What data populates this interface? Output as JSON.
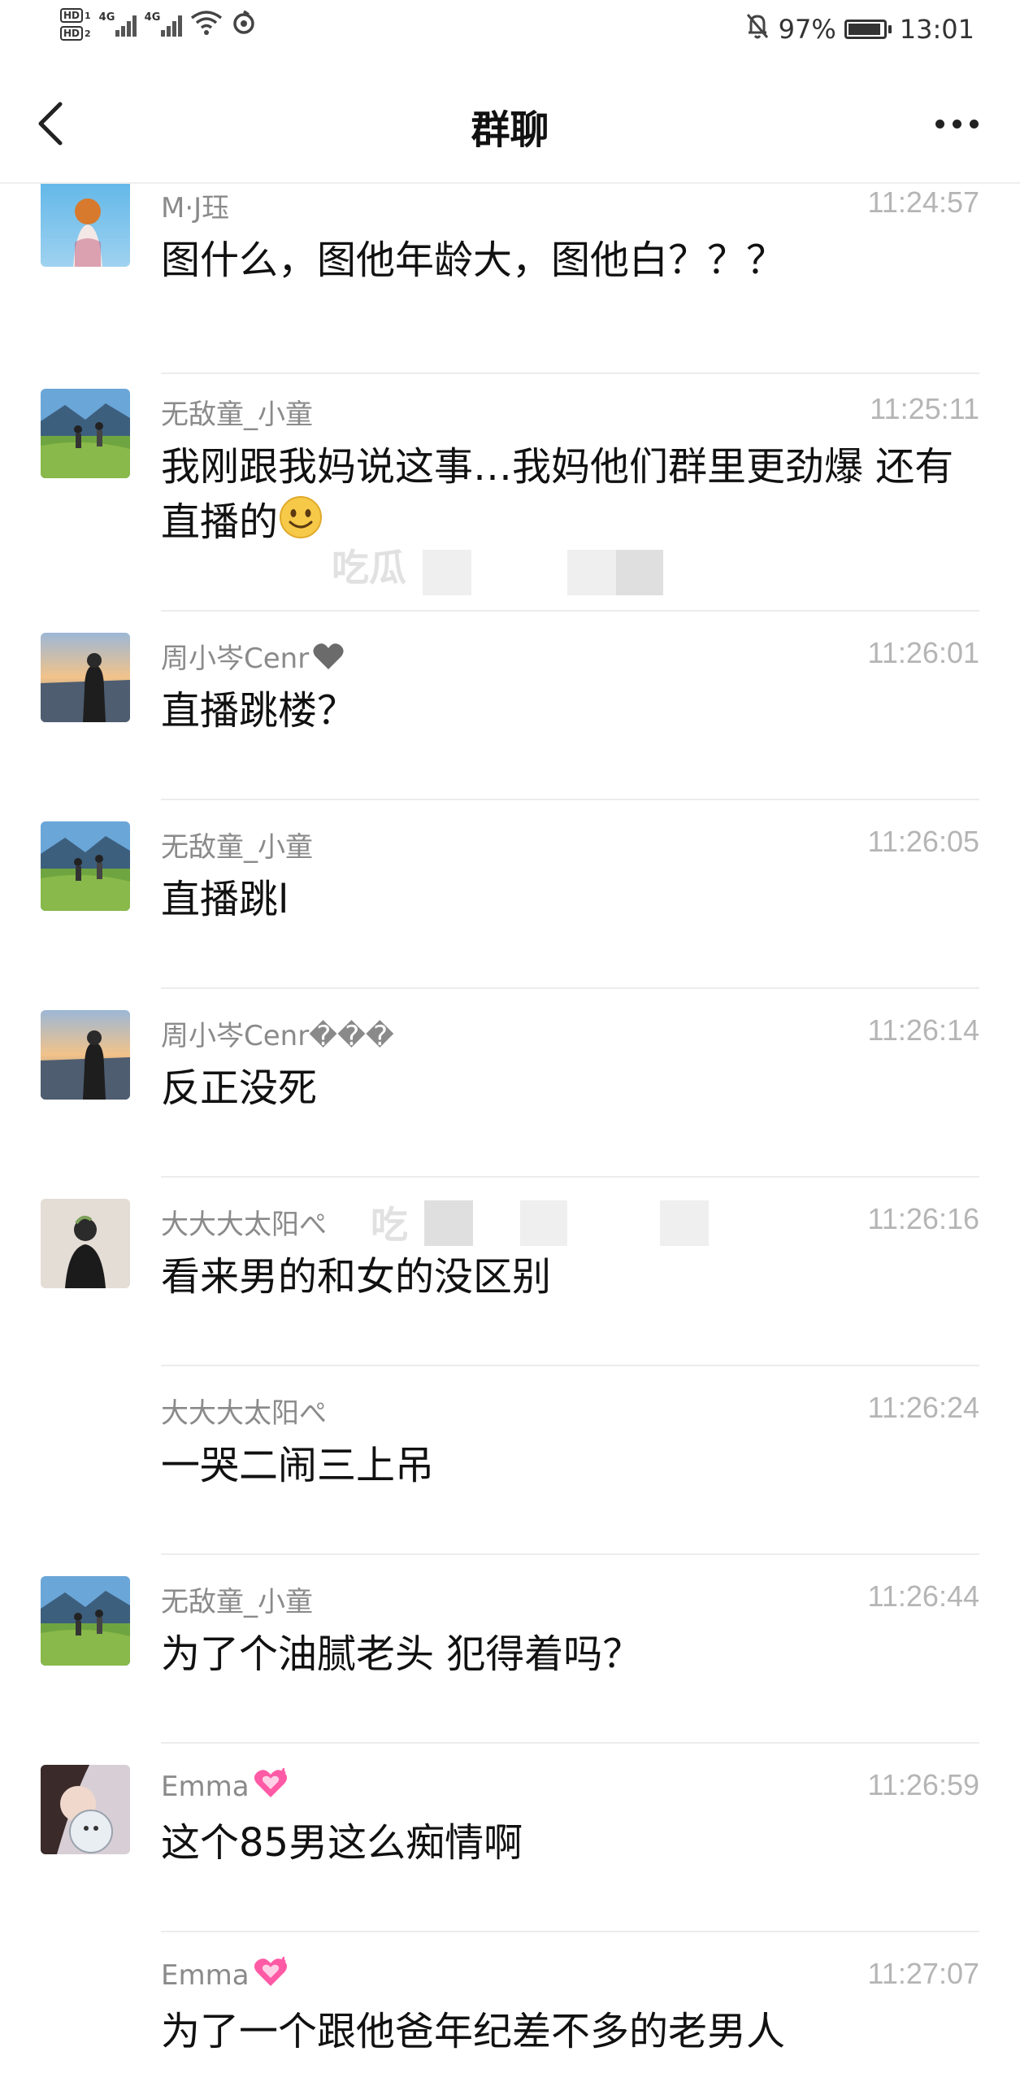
{
  "status_bar": {
    "hd1": "HD",
    "hd1_sub": "1",
    "hd2": "HD",
    "hd2_sub": "2",
    "signal1_label": "4G",
    "signal2_label": "4G",
    "battery": "97%",
    "time": "13:01"
  },
  "header": {
    "title": "群聊"
  },
  "messages": [
    {
      "sender": "M·J珏",
      "time": "11:24:57",
      "text": "图什么，图他年龄大，图他白？？？"
    },
    {
      "sender": "无敌童_小童",
      "time": "11:25:11",
      "text": "我刚跟我妈说这事…我妈他们群里更劲爆 还有直播的"
    },
    {
      "sender": "周小岑Cenr",
      "time": "11:26:01",
      "text": "直播跳楼？"
    },
    {
      "sender": "无敌童_小童",
      "time": "11:26:05",
      "text": "直播跳l"
    },
    {
      "sender": "周小岑Cenr���",
      "time": "11:26:14",
      "text": "反正没死"
    },
    {
      "sender": "大大大太阳ぺ",
      "time": "11:26:16",
      "text": "看来男的和女的没区别"
    },
    {
      "sender": "大大大太阳ぺ",
      "time": "11:26:24",
      "text": "一哭二闹三上吊"
    },
    {
      "sender": "无敌童_小童",
      "time": "11:26:44",
      "text": "为了个油腻老头 犯得着吗？"
    },
    {
      "sender": "Emma",
      "time": "11:26:59",
      "text": "这个85男这么痴情啊"
    },
    {
      "sender": "Emma",
      "time": "11:27:07",
      "text": "为了一个跟他爸年纪差不多的老男人"
    }
  ],
  "watermarks": {
    "wm1": "吃瓜",
    "wm2": "吃"
  },
  "icons": {
    "back": "chevron-left-icon",
    "more": "more-dots-icon",
    "smile": "smile-emoji-icon",
    "heart": "heart-emoji-icon"
  },
  "colors": {
    "sender_gray": "#8a8a8a",
    "time_gray": "#b5b5b5",
    "text": "#111111",
    "divider": "#ececec"
  }
}
